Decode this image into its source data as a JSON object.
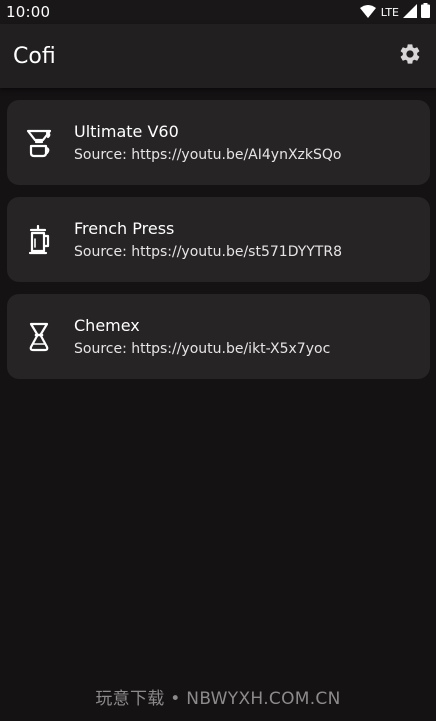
{
  "status_bar": {
    "time": "10:00",
    "network": "LTE",
    "icons": [
      "wifi-icon",
      "signal-icon",
      "battery-icon"
    ]
  },
  "app_bar": {
    "title": "Cofi",
    "settings_icon": "gear-icon"
  },
  "recipes": [
    {
      "name": "Ultimate V60",
      "source": "Source: https://youtu.be/AI4ynXzkSQo",
      "icon": "v60-dripper-icon"
    },
    {
      "name": "French Press",
      "source": "Source: https://youtu.be/st571DYYTR8",
      "icon": "french-press-icon"
    },
    {
      "name": "Chemex",
      "source": "Source: https://youtu.be/ikt-X5x7yoc",
      "icon": "chemex-icon"
    }
  ],
  "watermark": "玩意下载 • NBWYXH.COM.CN",
  "colors": {
    "background": "#141213",
    "app_bar": "#211f20",
    "card": "#262425",
    "text": "#ffffff"
  }
}
